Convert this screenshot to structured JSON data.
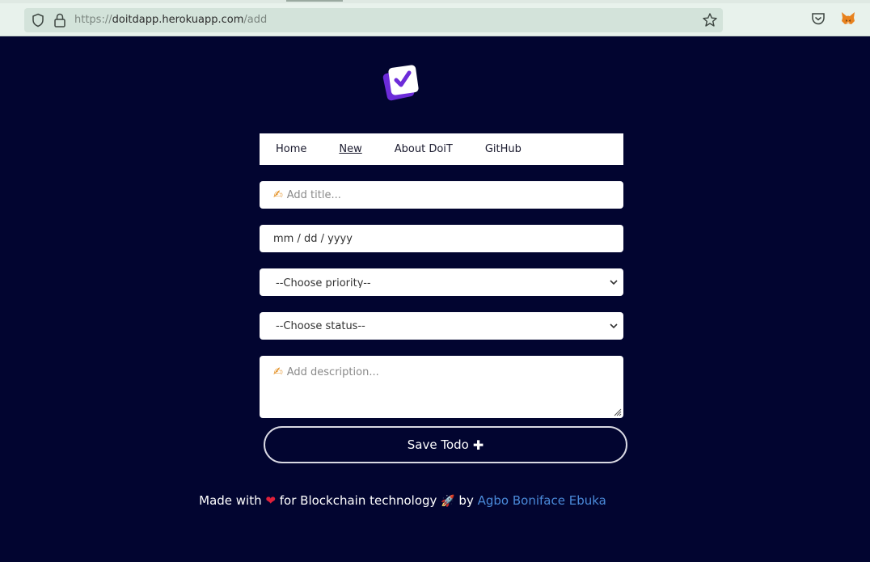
{
  "browser": {
    "url_scheme": "https://",
    "url_host": "doitdapp.herokuapp.com",
    "url_path": "/add"
  },
  "nav": {
    "items": [
      {
        "label": "Home"
      },
      {
        "label": "New"
      },
      {
        "label": "About DoiT"
      },
      {
        "label": "GitHub"
      }
    ]
  },
  "form": {
    "title_emoji": "✍",
    "title_placeholder": "Add title...",
    "date_placeholder": "mm / dd / yyyy",
    "priority_selected": "--Choose priority--",
    "status_selected": "--Choose status--",
    "description_emoji": "✍",
    "description_placeholder": "Add description...",
    "save_label": "Save Todo",
    "save_icon": "✚"
  },
  "footer": {
    "prefix": "Made with",
    "heart": "❤",
    "middle": "for Blockchain technology",
    "rocket": "🚀",
    "by": "by",
    "author": "Agbo Boniface Ebuka"
  },
  "colors": {
    "background": "#020530",
    "link": "#4a8ad9",
    "logo_purple": "#6c2bd9"
  }
}
